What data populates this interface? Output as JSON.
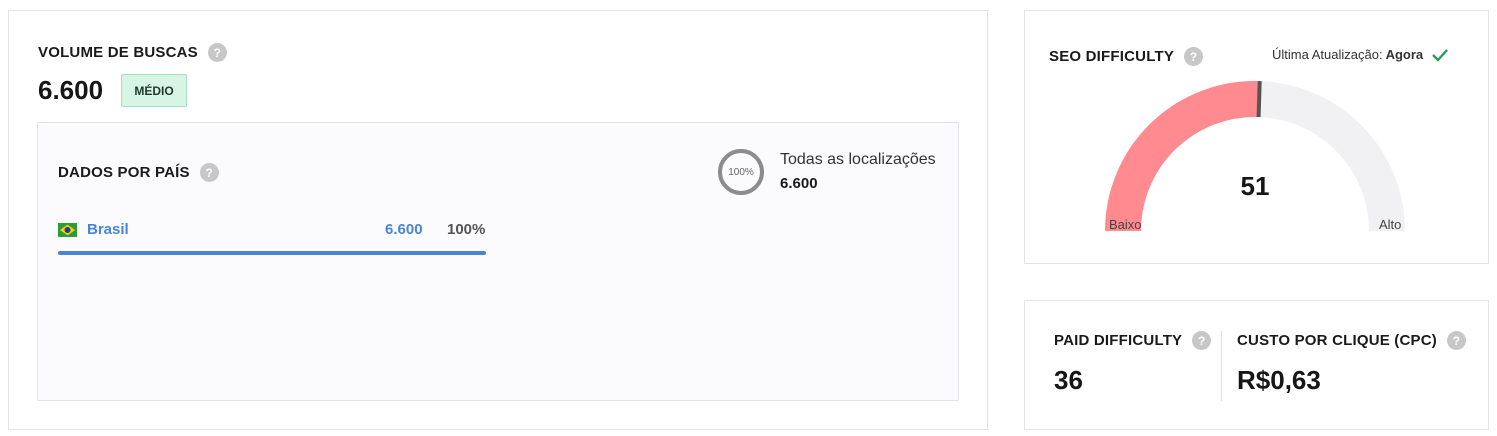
{
  "volume": {
    "title": "VOLUME DE BUSCAS",
    "value": "6.600",
    "badge": "MÉDIO",
    "country_panel": {
      "title": "DADOS POR PAÍS",
      "ring_percent": "100%",
      "ring_fraction": 1.0,
      "locations_label": "Todas as localizações",
      "locations_value": "6.600",
      "countries": [
        {
          "name": "Brasil",
          "value": "6.600",
          "percent": "100%",
          "fraction": 1.0
        }
      ]
    }
  },
  "seo": {
    "title": "SEO DIFFICULTY",
    "updated_label": "Última Atualização:",
    "updated_value": "Agora",
    "score": "51",
    "score_fraction": 0.51,
    "low_label": "Baixo",
    "high_label": "Alto",
    "colors": {
      "filled": "#ff8a8f",
      "empty": "#f1f1f3",
      "marker": "#555555"
    }
  },
  "paid": {
    "title": "PAID DIFFICULTY",
    "value": "36"
  },
  "cpc": {
    "title": "CUSTO POR CLIQUE (CPC)",
    "value": "R$0,63"
  },
  "icons": {
    "help": "help-icon",
    "check": "check-icon",
    "flag": "brazil-flag-icon"
  },
  "colors": {
    "accent": "#4a84d9",
    "badge_bg": "#d6f5e4",
    "check": "#2a9d5c"
  }
}
